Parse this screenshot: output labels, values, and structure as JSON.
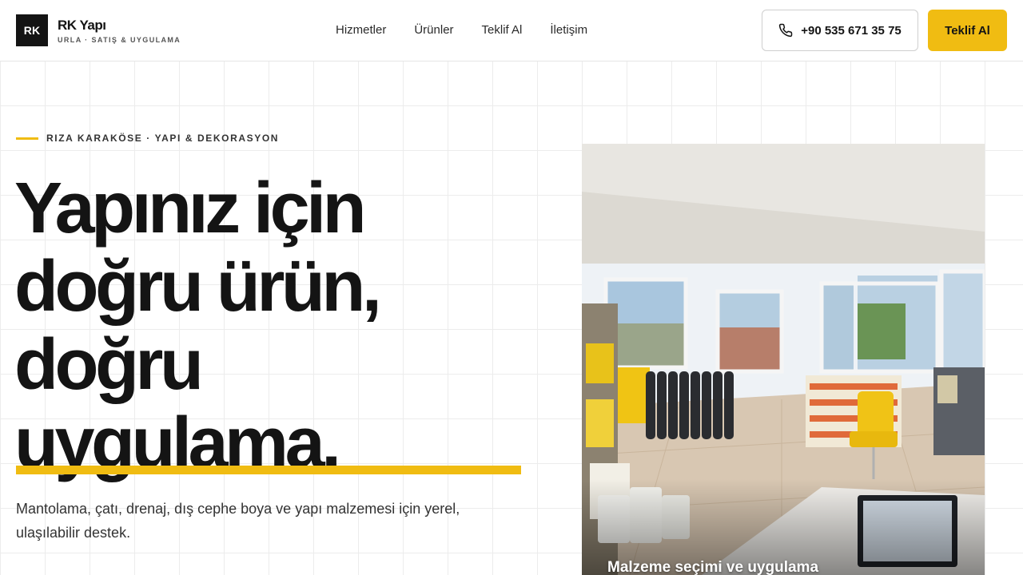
{
  "brand": {
    "mark": "RK",
    "name": "RK Yapı",
    "tagline": "URLA · SATIŞ & UYGULAMA"
  },
  "nav": [
    {
      "label": "Hizmetler"
    },
    {
      "label": "Ürünler"
    },
    {
      "label": "Teklif Al"
    },
    {
      "label": "İletişim"
    }
  ],
  "header": {
    "phone": "+90 535 671 35 75",
    "cta": "Teklif Al",
    "phone_icon": "phone-icon"
  },
  "hero": {
    "eyebrow": "RIZA KARAKÖSE · YAPI & DEKORASYON",
    "headline": [
      "Yapınız için",
      "doğru ürün,",
      "doğru",
      "uygulama."
    ],
    "lead": "Mantolama, çatı, drenaj, dış cephe boya ve yapı malzemesi için yerel, ulaşılabilir destek.",
    "image_caption": "Malzeme seçimi ve uygulama"
  },
  "colors": {
    "accent": "#f0bc12",
    "ink": "#141414",
    "grid": "#ececec"
  }
}
